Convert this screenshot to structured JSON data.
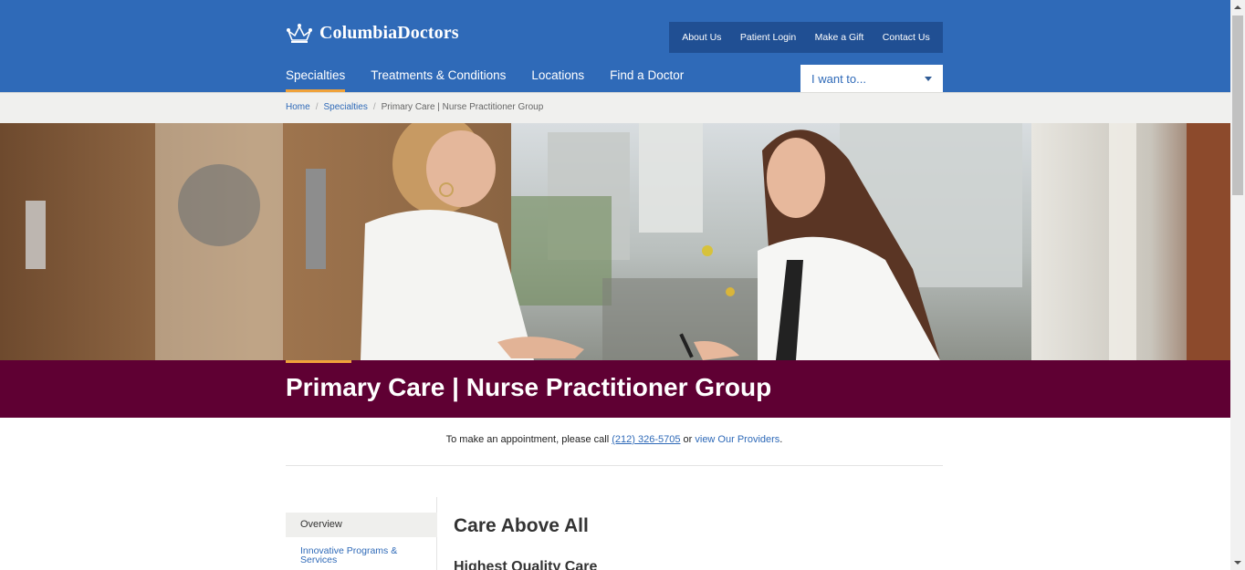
{
  "header": {
    "logo_text": "ColumbiaDoctors",
    "utility_links": [
      "About Us",
      "Patient Login",
      "Make a Gift",
      "Contact Us"
    ],
    "main_nav": [
      "Specialties",
      "Treatments & Conditions",
      "Locations",
      "Find a Doctor"
    ],
    "active_nav": "Specialties",
    "i_want_to": "I want to..."
  },
  "breadcrumb": {
    "home": "Home",
    "specialties": "Specialties",
    "current": "Primary Care | Nurse Practitioner Group"
  },
  "hero": {
    "icon": "hero-photo-clinicians"
  },
  "page": {
    "title": "Primary Care | Nurse Practitioner Group"
  },
  "appointment": {
    "text_before": "To make an appointment, please call ",
    "phone": "(212) 326-5705",
    "text_middle": " or ",
    "providers_link": "view Our Providers",
    "text_after": "."
  },
  "sidebar": {
    "items": [
      "Overview",
      "Innovative Programs & Services"
    ]
  },
  "content": {
    "section_title": "Care Above All",
    "subsection_title": "Highest Quality Care"
  },
  "colors": {
    "brand_blue": "#2f6ab8",
    "utility_bar": "#204f93",
    "accent_orange": "#f0a23a",
    "title_band": "#5f0033"
  }
}
